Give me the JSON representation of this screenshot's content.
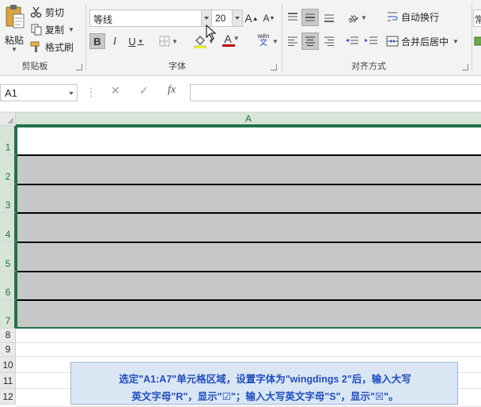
{
  "clipboard": {
    "paste_label": "粘贴",
    "cut_label": "剪切",
    "copy_label": "复制",
    "format_painter_label": "格式刷",
    "group_label": "剪贴板"
  },
  "font": {
    "name": "等线",
    "size": "20",
    "bold": "B",
    "italic": "I",
    "underline": "U",
    "grow": "A",
    "shrink": "A",
    "font_color_glyph": "A",
    "font_color": "#c00000",
    "phonetic_top": "wén",
    "phonetic_bottom": "文",
    "group_label": "字体"
  },
  "alignment": {
    "wrap_text_label": "自动换行",
    "merge_center_label": "合并后居中",
    "group_label": "对齐方式"
  },
  "number": {
    "format_partial": "常"
  },
  "formula_bar": {
    "name_box": "A1",
    "fx": "fx"
  },
  "grid": {
    "column_a": "A",
    "rows": [
      "1",
      "2",
      "3",
      "4",
      "5",
      "6",
      "7",
      "8",
      "9",
      "10",
      "11",
      "12"
    ],
    "selection_color": "#217346",
    "shade_color": "#c7c7c7"
  },
  "annotation": {
    "line1": "选定\"A1:A7\"单元格区域，设置字体为\"wingdings 2\"后，输入大写",
    "line2": "英文字母\"R\"，显示\"☑\"；输入大写英文字母\"S\"，显示\"☒\"。"
  }
}
